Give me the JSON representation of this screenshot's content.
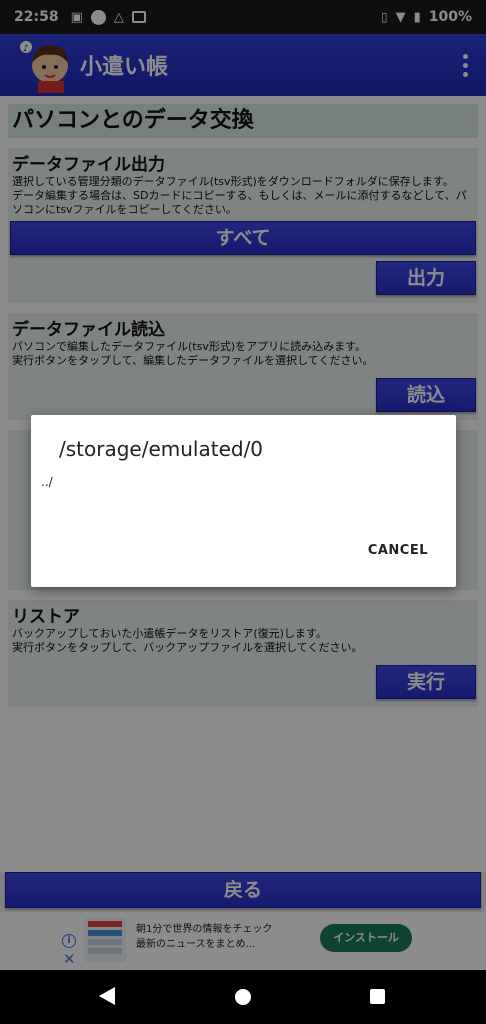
{
  "status_bar": {
    "time": "22:58",
    "battery": "100%"
  },
  "app": {
    "title": "小遣い帳"
  },
  "page": {
    "section_title": "パソコンとのデータ交換"
  },
  "export_card": {
    "title": "データファイル出力",
    "description": "選択している管理分類のデータファイル(tsv形式)をダウンロードフォルダに保存します。\nデータ編集する場合は、SDカードにコピーする、もしくは、メールに添付するなどして、パソコンにtsvファイルをコピーしてください。",
    "all_button": "すべて",
    "export_button": "出力"
  },
  "import_card": {
    "title": "データファイル読込",
    "description": "パソコンで編集したデータファイル(tsv形式)をアプリに読み込みます。\n実行ボタンをタップして、編集したデータファイルを選択してください。",
    "import_button": "読込"
  },
  "restore_card": {
    "title": "リストア",
    "description": "バックアップしておいた小遣帳データをリストア(復元)します。\n実行ボタンをタップして、バックアップファイルを選択してください。",
    "run_button": "実行"
  },
  "back_button": "戻る",
  "dialog": {
    "title": "/storage/emulated/0",
    "items": [
      "../"
    ],
    "cancel": "CANCEL"
  },
  "ad": {
    "line1": "朝1分で世界の情報をチェック",
    "line2": "最新のニュースをまとめ...",
    "install": "インストール"
  }
}
